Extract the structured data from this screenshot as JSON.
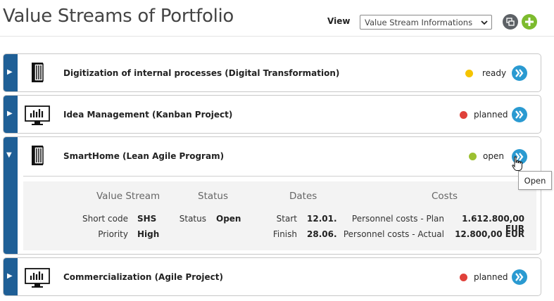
{
  "header": {
    "title": "Value Streams of Portfolio",
    "view_label": "View",
    "view_selected": "Value Stream Informations",
    "settings_icon": "filter-settings-icon",
    "add_icon": "add-icon"
  },
  "items": [
    {
      "title": "Digitization of internal processes (Digital Transformation)",
      "status": "ready",
      "status_color": "#f5c400",
      "icon": "book-icon",
      "expanded": false
    },
    {
      "title": "Idea Management (Kanban Project)",
      "status": "planned",
      "status_color": "#e0413a",
      "icon": "kanban-board-icon",
      "expanded": false
    },
    {
      "title": "SmartHome (Lean Agile Program)",
      "status": "open",
      "status_color": "#9cc031",
      "icon": "book-icon",
      "expanded": true
    },
    {
      "title": "Commercialization (Agile Project)",
      "status": "planned",
      "status_color": "#e0413a",
      "icon": "kanban-board-icon",
      "expanded": false
    }
  ],
  "details": {
    "headers": {
      "value_stream": "Value Stream",
      "status": "Status",
      "dates": "Dates",
      "costs": "Costs"
    },
    "short_code_label": "Short code",
    "short_code": "SHS",
    "priority_label": "Priority",
    "priority": "High",
    "status_label": "Status",
    "status": "Open",
    "start_label": "Start",
    "start": "12.01.",
    "finish_label": "Finish",
    "finish": "28.06.",
    "cost_plan_label": "Personnel costs - Plan",
    "cost_plan": "1.612.800,00 EUR",
    "cost_actual_label": "Personnel costs - Actual",
    "cost_actual": "12.800,00 EUR"
  },
  "tooltip": "Open",
  "colors": {
    "accent": "#1f5f96",
    "button": "#2a9ad1",
    "add": "#7dbb2e"
  }
}
